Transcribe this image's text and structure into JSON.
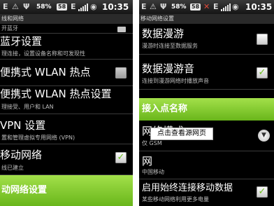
{
  "left": {
    "status": {
      "battery": "58%",
      "badge": "58",
      "time": "10:35",
      "notify_e": "E",
      "notify_warn": "⚠",
      "notify_usb": "Ψ"
    },
    "title": "线和网络",
    "items": [
      {
        "title": "",
        "summary": "开蓝牙"
      },
      {
        "title": "蓝牙设置",
        "summary": "理连接，设置设备名称和可发现性"
      },
      {
        "title": "便携式 WLAN 热点",
        "summary": ""
      },
      {
        "title": "便携式 WLAN 热点设置",
        "summary": "理接受、用户和 LAN"
      },
      {
        "title": "VPN 设置",
        "summary": "置和管理虚拟专用网络 (VPN)"
      },
      {
        "title": "移动网络",
        "summary": "线已建立"
      }
    ],
    "bottom_header": "动网络设置"
  },
  "right": {
    "status": {
      "battery": "58%",
      "badge": "58",
      "time": "10:35",
      "notify_e": "E",
      "notify_warn": "⚠",
      "notify_usb": "Ψ",
      "notify_x": "✕"
    },
    "title": "移动网络设置",
    "items": [
      {
        "title": "数据漫游",
        "summary": "漫游时连接至数据服务"
      },
      {
        "title": "数据漫游音",
        "summary": "连接到漫游网络时播放声音"
      }
    ],
    "section_header": "接入点名称",
    "network_mode": {
      "title": "网络模式",
      "summary": "仅 GSM"
    },
    "operator": {
      "title": "网",
      "summary": "中国移动"
    },
    "always_connect": {
      "title": "启用始终连接移动数据",
      "summary": "某些移动网络利用更多电量"
    }
  },
  "tooltip": "点击查看源网页"
}
